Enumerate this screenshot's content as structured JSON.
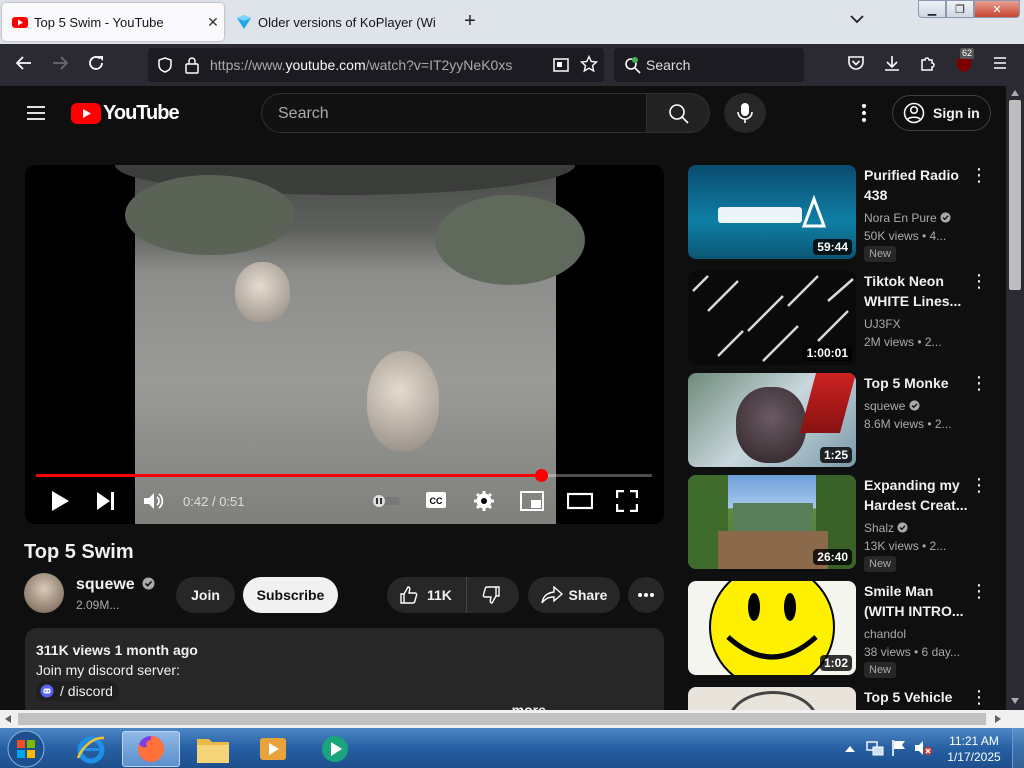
{
  "browser": {
    "tabs": [
      {
        "title": "Top 5 Swim - YouTube",
        "active": true
      },
      {
        "title": "Older versions of KoPlayer (Wi"
      }
    ],
    "url_prefix": "https://www.",
    "url_domain": "youtube.com",
    "url_path": "/watch?v=IT2yyNeK0xs",
    "search_placeholder": "Search",
    "extension_badge": "62"
  },
  "youtube": {
    "logo_text": "YouTube",
    "search_placeholder": "Search",
    "sign_in": "Sign in",
    "player": {
      "current_time": "0:42",
      "time_separator": "/",
      "duration": "0:51",
      "progress": 0.82
    },
    "video": {
      "title": "Top 5 Swim",
      "channel": "squewe",
      "subscribers": "2.09M...",
      "join_label": "Join",
      "subscribe_label": "Subscribe",
      "likes": "11K",
      "share_label": "Share",
      "description": {
        "stats": "311K views  1 month ago",
        "line": "Join my discord server:",
        "discord_tag": "/ discord",
        "more": "...more"
      }
    },
    "recommended": [
      {
        "title": "Purified Radio 438",
        "channel": "Nora En Pure",
        "verified": true,
        "meta": "50K views  • 4...",
        "badge": "New",
        "duration": "59:44"
      },
      {
        "title": "Tiktok Neon WHITE Lines...",
        "channel": "UJ3FX",
        "verified": false,
        "meta": "2M views  • 2...",
        "badge": "",
        "duration": "1:00:01"
      },
      {
        "title": "Top 5 Monke",
        "channel": "squewe",
        "verified": true,
        "meta": "8.6M views  • 2...",
        "badge": "",
        "duration": "1:25"
      },
      {
        "title": "Expanding my Hardest Creat...",
        "channel": "Shalz",
        "verified": true,
        "meta": "13K views  • 2...",
        "badge": "New",
        "duration": "26:40"
      },
      {
        "title": "Smile Man (WITH INTRO...",
        "channel": "chandol",
        "verified": false,
        "meta": "38 views  • 6 day...",
        "badge": "New",
        "duration": "1:02"
      },
      {
        "title": "Top 5 Vehicle",
        "channel": "",
        "verified": false,
        "meta": "",
        "badge": "",
        "duration": ""
      }
    ]
  },
  "taskbar": {
    "time": "11:21 AM",
    "date": "1/17/2025"
  }
}
